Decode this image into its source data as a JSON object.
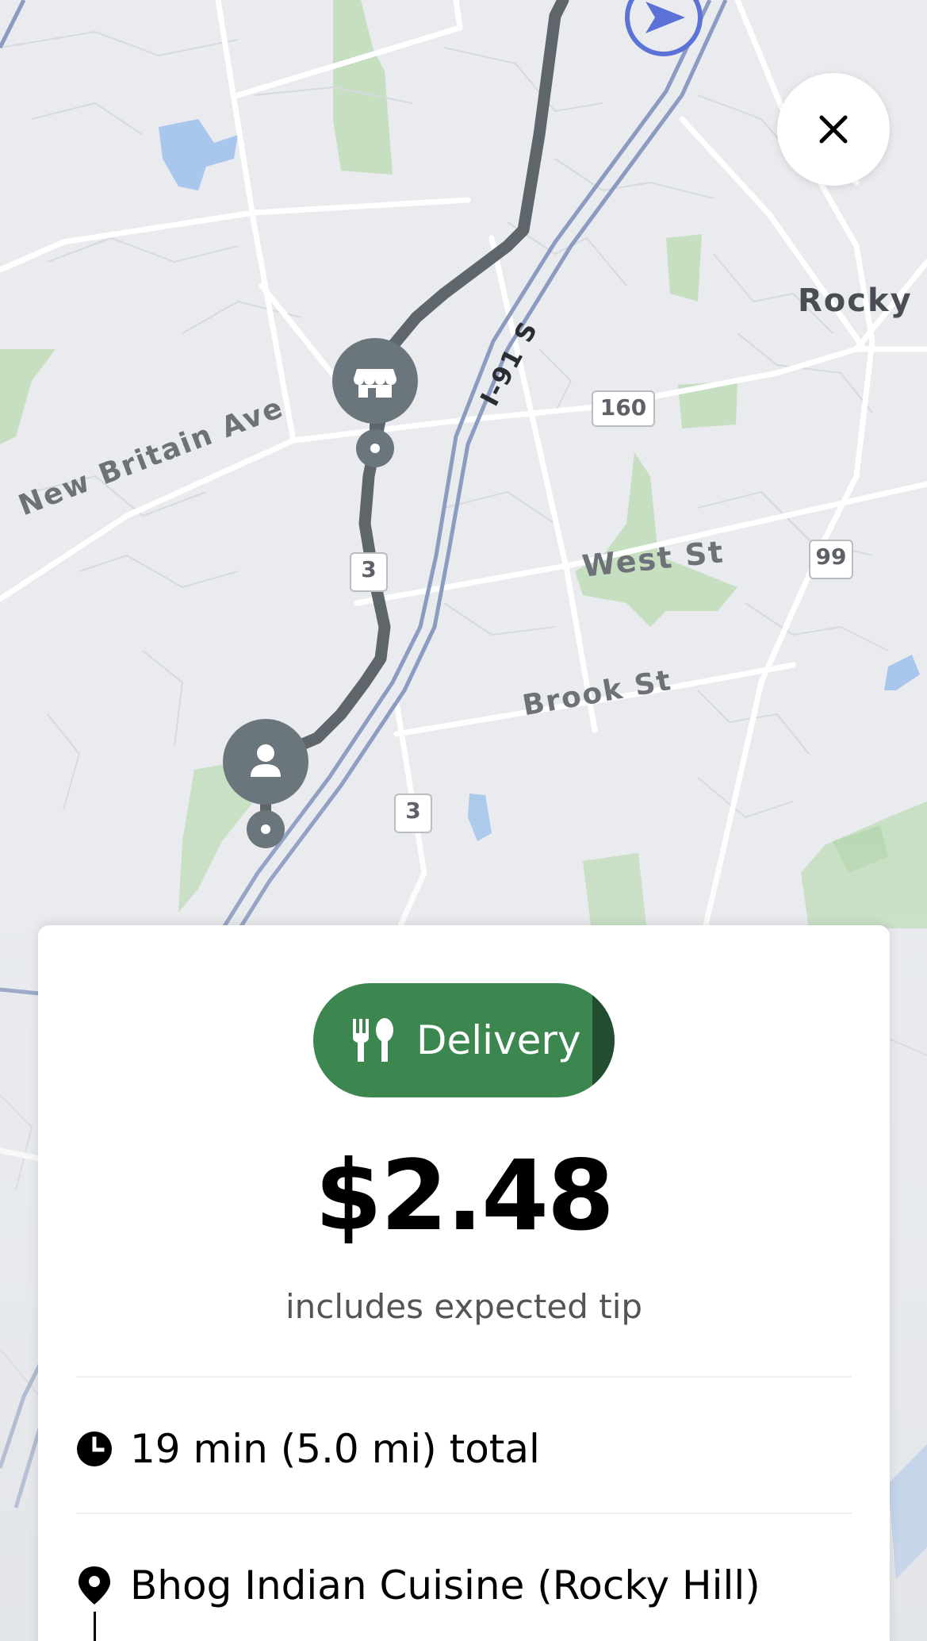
{
  "map": {
    "labels": {
      "new_britain": "New Britain Ave",
      "i91": "I-91 S",
      "west_st": "West St",
      "brook_st": "Brook St",
      "rocky": "Rocky"
    },
    "route_badges": {
      "r160": "160",
      "r3_top": "3",
      "r3_bottom": "3",
      "r99": "99"
    }
  },
  "icons": {
    "close": "close-icon",
    "store": "store-icon",
    "person": "person-icon",
    "navigation": "navigation-arrow-icon",
    "utensils": "fork-spoon-icon",
    "clock": "clock-icon",
    "pin": "location-pin-icon"
  },
  "offer": {
    "type_label": "Delivery",
    "price": "$2.48",
    "price_note": "includes expected tip",
    "trip_summary": "19 min (5.0 mi) total",
    "pickup_name": "Bhog Indian Cuisine (Rocky Hill)"
  },
  "colors": {
    "delivery_green": "#3b874f",
    "route_gray": "#5e666c",
    "highway_blue": "#8c9cc0"
  }
}
